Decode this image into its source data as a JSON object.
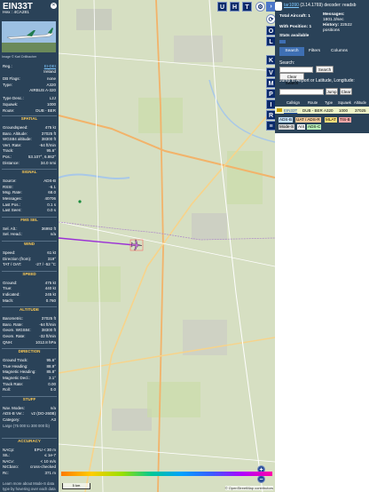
{
  "aircraft": {
    "callsign": "EIN33T",
    "hex_label": "Hex :",
    "hex": "4CA281",
    "photo_credit": "Image © Karl Drillbacher",
    "registration": {
      "label": "Reg.:",
      "value": "EI-DEI"
    },
    "country": "Ireland",
    "db_flags": {
      "label": "DB Flags:",
      "value": "none"
    },
    "type": {
      "label": "Type:",
      "value": "A320"
    },
    "type_full": "AIRBUS A-320",
    "type_desc": {
      "label": "Type Desc.:",
      "value": "L2J"
    },
    "squawk": {
      "label": "Squawk:",
      "value": "1000"
    },
    "route": {
      "label": "Route:",
      "value": "DUB - BER"
    }
  },
  "sections": {
    "spatial": {
      "title": "SPATIAL",
      "rows": [
        {
          "k": "Groundspeed:",
          "v": "475 kt"
        },
        {
          "k": "Baro. Altitude:",
          "v": "37025 ft"
        },
        {
          "k": "WGS84 altitude:",
          "v": "38300 ft"
        },
        {
          "k": "Vert. Rate:",
          "v": "-64 ft/min"
        },
        {
          "k": "Track:",
          "v": "95.6°"
        },
        {
          "k": "Pos.:",
          "v": "53.107°, 6.862°"
        },
        {
          "k": "Distance:",
          "v": "34.0 nmi"
        }
      ]
    },
    "signal": {
      "title": "SIGNAL",
      "rows": [
        {
          "k": "Source:",
          "v": "ADS-B"
        },
        {
          "k": "RSSI:",
          "v": "-6.1"
        },
        {
          "k": "Msg. Rate:",
          "v": "68.0"
        },
        {
          "k": "Messages:",
          "v": "40706"
        },
        {
          "k": "Last Pos.:",
          "v": "0.1 s"
        },
        {
          "k": "Last Seen:",
          "v": "0.0 s"
        }
      ]
    },
    "fms_sel": {
      "title": "FMS SEL",
      "rows": [
        {
          "k": "Sel. Alt.:",
          "v": "36992 ft"
        },
        {
          "k": "Sel. Head.:",
          "v": "n/a"
        }
      ]
    },
    "wind": {
      "title": "WIND",
      "rows": [
        {
          "k": "Speed:",
          "v": "61 kt"
        },
        {
          "k": "Direction (from):",
          "v": "319°"
        },
        {
          "k": "TAT / OAT:",
          "v": "-27 / -52 °C"
        }
      ]
    },
    "speed": {
      "title": "SPEED",
      "rows": [
        {
          "k": "Ground:",
          "v": "475 kt"
        },
        {
          "k": "True:",
          "v": "440 kt"
        },
        {
          "k": "Indicated:",
          "v": "245 kt"
        },
        {
          "k": "Mach:",
          "v": "0.760"
        }
      ]
    },
    "altitude": {
      "title": "ALTITUDE",
      "rows": [
        {
          "k": "Barometric:",
          "v": "37025 ft"
        },
        {
          "k": "Baro. Rate:",
          "v": "-64 ft/min"
        },
        {
          "k": "Geom. WGS84:",
          "v": "38300 ft"
        },
        {
          "k": "Geom. Rate:",
          "v": "-32 ft/min"
        },
        {
          "k": "QNH:",
          "v": "1012.8 hPa"
        }
      ]
    },
    "direction": {
      "title": "DIRECTION",
      "rows": [
        {
          "k": "Ground Track:",
          "v": "95.6°"
        },
        {
          "k": "True Heading:",
          "v": "88.9°"
        },
        {
          "k": "Magnetic Heading:",
          "v": "85.8°"
        },
        {
          "k": "Magnetic Decl.:",
          "v": "3.1°"
        },
        {
          "k": "Track Rate:",
          "v": "0.00"
        },
        {
          "k": "Roll:",
          "v": "0.0"
        }
      ]
    },
    "stuff": {
      "title": "STUFF",
      "rows": [
        {
          "k": "Nav. Modes:",
          "v": "n/a"
        },
        {
          "k": "ADS-B Ver.:",
          "v": "v2 (DO-260B)"
        },
        {
          "k": "Category:",
          "v": "A3"
        }
      ],
      "category_desc": "Large (75 000 to 300 000 lb)"
    },
    "accuracy": {
      "title": "ACCURACY",
      "rows": [
        {
          "k": "NACp:",
          "v": "EPU < 30 m"
        },
        {
          "k": "SIL:",
          "v": "≤ 1e-7"
        },
        {
          "k": "NACv:",
          "v": "< 10 m/s"
        },
        {
          "k": "NICbaro:",
          "v": "cross-checked"
        },
        {
          "k": "Rc:",
          "v": "371 m"
        }
      ]
    },
    "footer": "Learn more about Mode-S data type by hovering over each data label."
  },
  "map_controls": {
    "top_buttons": [
      "U",
      "H",
      "T"
    ],
    "side_buttons": [
      "O",
      "K",
      "L",
      "V",
      "M",
      "P",
      "I",
      "R"
    ],
    "zoom_in": "+",
    "zoom_out": "−",
    "attribution": "© OpenStreetMap contributors",
    "scale": "5 km"
  },
  "right_panel": {
    "version_link": "tar1090",
    "version_text": "(3.14.1769) decoder: readsb",
    "stats": {
      "total_label": "Total Aircraft:",
      "total_value": "1",
      "positions_label": "With Position:",
      "positions_value": "1",
      "messages_label": "Messages:",
      "messages_value": "1801.3/sec",
      "history_label": "History:",
      "history_value": "22522 positions",
      "stats_label": "Stats available"
    },
    "tabs": [
      "Search",
      "Filters",
      "Columns"
    ],
    "search_label": "Search:",
    "search_button": "Search",
    "clear_search_button": "Clear Search",
    "jump_label": "Jump to Airport or Latitude, Longitude:",
    "jump_button": "Jump",
    "clear_button": "Clear",
    "table": {
      "headers": [
        "Callsign",
        "Route",
        "Type",
        "Squawk",
        "Altitude"
      ],
      "rows": [
        [
          "EIN33T",
          "DUB - BER",
          "A320",
          "1000",
          "37025"
        ]
      ]
    },
    "badges": [
      {
        "label": "ADS-B",
        "bg": "#c6e2ff"
      },
      {
        "label": "UAT / ADS-R",
        "bg": "#f0c89a"
      },
      {
        "label": "MLAT",
        "bg": "#ffe07a"
      },
      {
        "label": "TIS-B",
        "bg": "#f9a8a8"
      },
      {
        "label": "Mode-S",
        "bg": "#d8d8d8"
      },
      {
        "label": "AIS",
        "bg": "#ffffff"
      },
      {
        "label": "ADS-C",
        "bg": "#b8f0b8"
      }
    ]
  },
  "colors": {
    "panel": "#2a4258",
    "accent": "#3e6fb3",
    "track": "#9a2fd6",
    "section_title": "#ffcc55"
  }
}
